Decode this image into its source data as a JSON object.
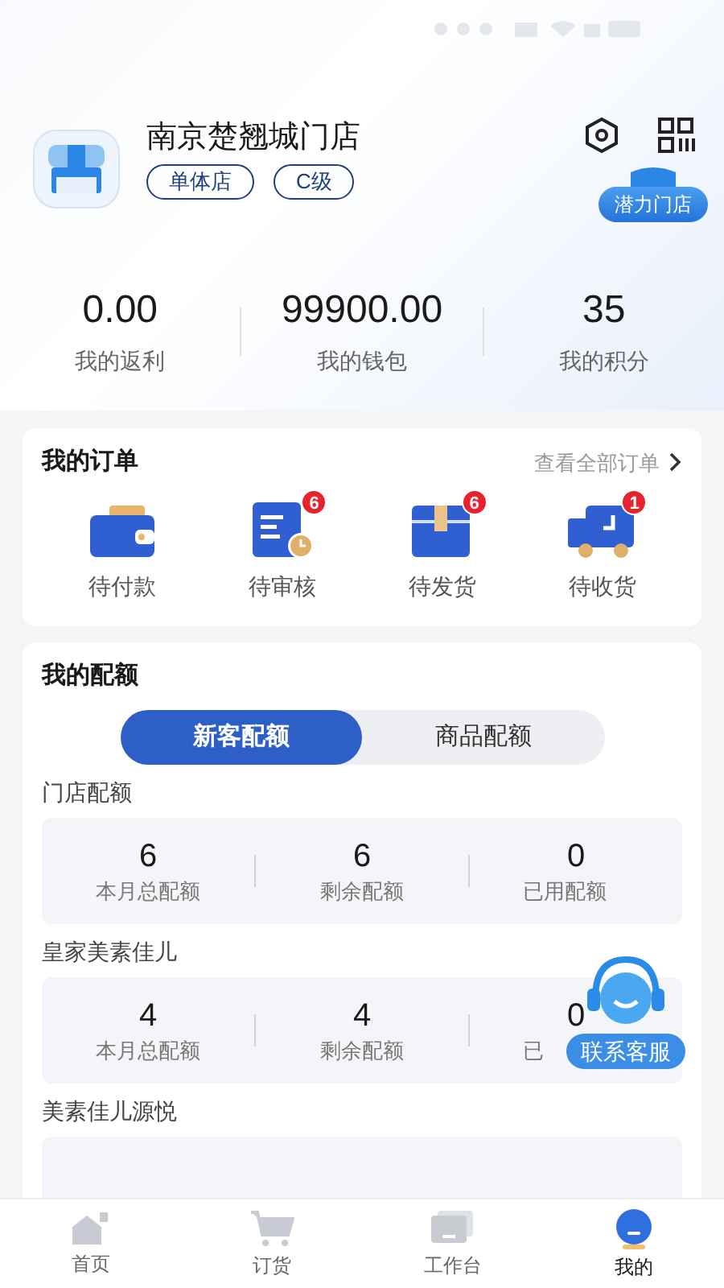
{
  "store": {
    "name": "南京楚翘城门店",
    "tags": [
      "单体店",
      "C级"
    ],
    "badge": "潜力门店"
  },
  "stats": [
    {
      "value": "0.00",
      "label": "我的返利"
    },
    {
      "value": "99900.00",
      "label": "我的钱包"
    },
    {
      "value": "35",
      "label": "我的积分"
    }
  ],
  "orders": {
    "title": "我的订单",
    "link": "查看全部订单",
    "items": [
      {
        "kind": "wallet",
        "label": "待付款"
      },
      {
        "kind": "document",
        "label": "待审核",
        "badge": "6"
      },
      {
        "kind": "box",
        "label": "待发货",
        "badge": "6"
      },
      {
        "kind": "truck",
        "label": "待收货",
        "badge": "1"
      }
    ]
  },
  "quota": {
    "title": "我的配额",
    "tabs": [
      {
        "label": "新客配额",
        "selected": true
      },
      {
        "label": "商品配额",
        "selected": false
      }
    ],
    "groups": [
      {
        "name": "门店配额",
        "cells": [
          {
            "value": "6",
            "label": "本月总配额"
          },
          {
            "value": "6",
            "label": "剩余配额"
          },
          {
            "value": "0",
            "label": "已用配额"
          }
        ]
      },
      {
        "name": "皇家美素佳儿",
        "cells": [
          {
            "value": "4",
            "label": "本月总配额"
          },
          {
            "value": "4",
            "label": "剩余配额"
          },
          {
            "value": "0",
            "label": "已"
          }
        ]
      },
      {
        "name": "美素佳儿源悦"
      }
    ]
  },
  "service_button": {
    "label": "联系客服"
  },
  "tab_bar": [
    {
      "kind": "home",
      "label": "首页",
      "selected": false
    },
    {
      "kind": "cart",
      "label": "订货",
      "selected": false
    },
    {
      "kind": "desk",
      "label": "工作台",
      "selected": false
    },
    {
      "kind": "me",
      "label": "我的",
      "selected": true
    }
  ]
}
